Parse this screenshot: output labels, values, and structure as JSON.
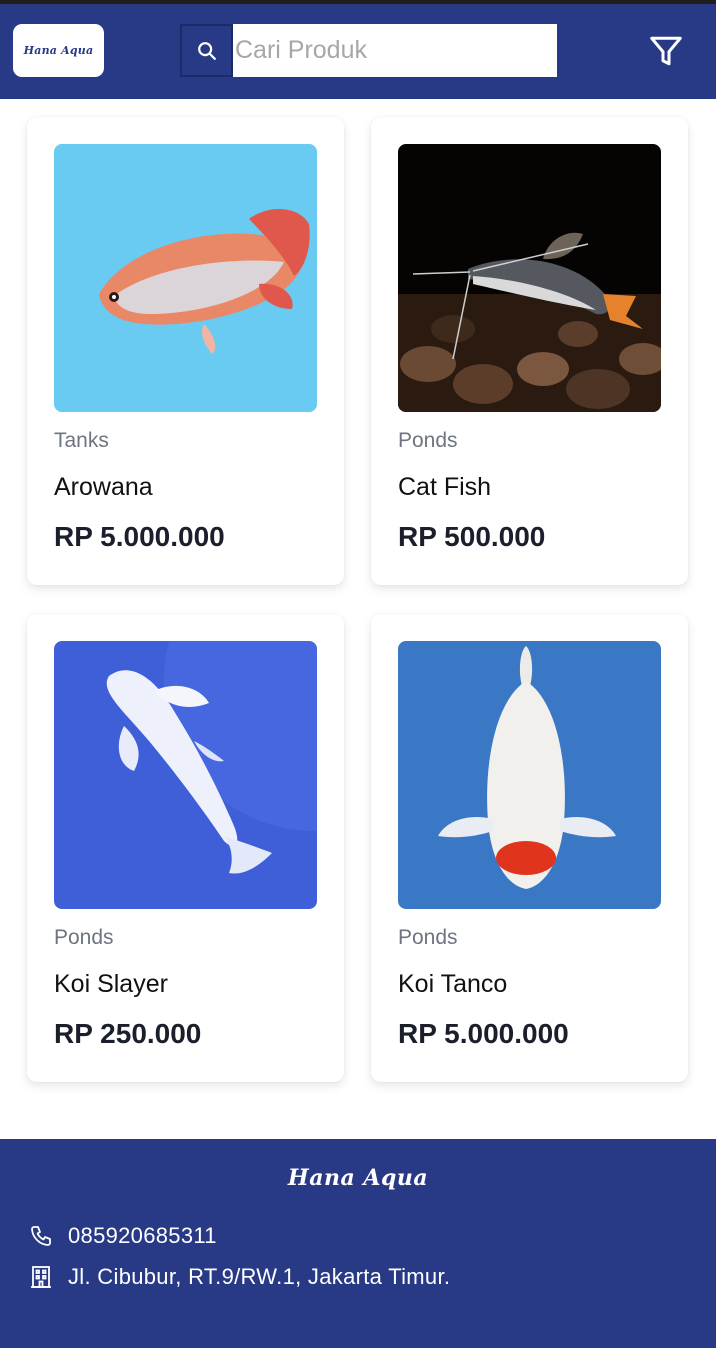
{
  "header": {
    "logo_text": "Hana Aqua",
    "search": {
      "placeholder": "Cari Produk",
      "value": "",
      "icon": "search-icon"
    },
    "filter_icon": "filter-icon"
  },
  "products": [
    {
      "category": "Tanks",
      "name": "Arowana",
      "price": "RP 5.000.000"
    },
    {
      "category": "Ponds",
      "name": "Cat Fish",
      "price": "RP 500.000"
    },
    {
      "category": "Ponds",
      "name": "Koi Slayer",
      "price": "RP 250.000"
    },
    {
      "category": "Ponds",
      "name": "Koi Tanco",
      "price": "RP 5.000.000"
    }
  ],
  "footer": {
    "brand": "Hana Aqua",
    "phone": "085920685311",
    "address": "Jl. Cibubur, RT.9/RW.1, Jakarta Timur."
  },
  "colors": {
    "primary": "#283a85",
    "card_bg": "#ffffff",
    "muted_text": "#6d7580"
  }
}
